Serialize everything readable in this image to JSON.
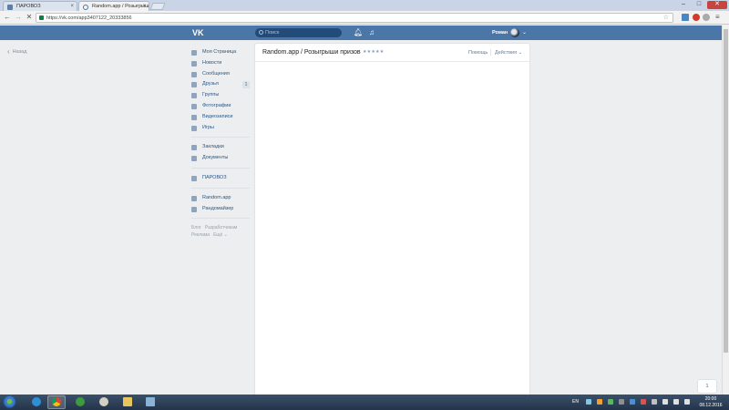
{
  "browser": {
    "tabs": [
      {
        "label": "ПАРОВОЗ",
        "active": false
      },
      {
        "label": "Random.app / Розыгрыш",
        "active": true
      }
    ],
    "url": "https://vk.com/app3407122_20333856",
    "window_controls": {
      "minimize": "–",
      "maximize": "□",
      "close": "✕"
    }
  },
  "vk": {
    "logo": "VK",
    "search": {
      "placeholder": "Поиск"
    },
    "user": {
      "name": "Роман"
    },
    "back_label": "Назад",
    "menu": {
      "items": [
        {
          "label": "Моя Страница",
          "icon": "home-icon"
        },
        {
          "label": "Новости",
          "icon": "news-icon"
        },
        {
          "label": "Сообщения",
          "icon": "messages-icon"
        },
        {
          "label": "Друзья",
          "icon": "friends-icon",
          "badge": "1"
        },
        {
          "label": "Группы",
          "icon": "groups-icon"
        },
        {
          "label": "Фотографии",
          "icon": "photos-icon"
        },
        {
          "label": "Видеозаписи",
          "icon": "video-icon"
        },
        {
          "label": "Игры",
          "icon": "games-icon"
        }
      ],
      "items2": [
        {
          "label": "Закладки",
          "icon": "bookmark-icon"
        },
        {
          "label": "Документы",
          "icon": "documents-icon"
        }
      ],
      "items3": [
        {
          "label": "ПАРОВОЗ",
          "icon": "group-icon"
        }
      ],
      "items4": [
        {
          "label": "Random.app",
          "icon": "app-icon"
        },
        {
          "label": "Рандомайзер",
          "icon": "app-icon"
        }
      ],
      "footer": [
        "Блог",
        "Разработчикам",
        "Реклама",
        "Ещё ⌄"
      ]
    },
    "app": {
      "title": "Random.app / Розыгрыши призов",
      "rating_stars": "★★★★★",
      "help": "Помощь",
      "actions": "Действия ⌄"
    },
    "bubble": "1"
  },
  "taskbar": {
    "language": "EN",
    "time": "20:00",
    "date": "08.12.2016"
  }
}
